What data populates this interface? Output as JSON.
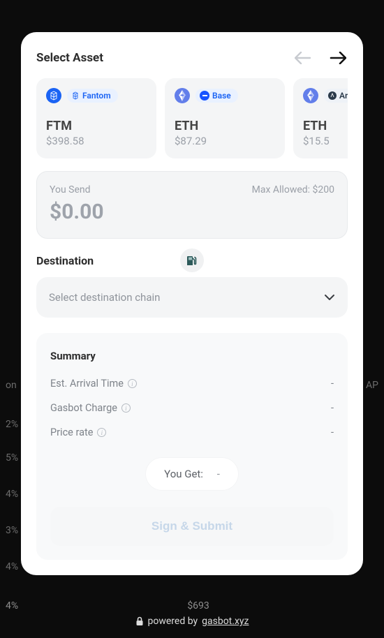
{
  "header": {
    "title": "Select Asset"
  },
  "assets": [
    {
      "chain": "Fantom",
      "symbol": "FTM",
      "value": "$398.58",
      "iconColor": "#1a63f4",
      "pillBg": "#e9f1ff",
      "pillColor": "#1a63f4"
    },
    {
      "chain": "Base",
      "symbol": "ETH",
      "value": "$87.29",
      "iconColor": "#627eea",
      "pillBg": "#e9f1ff",
      "pillColor": "#1a63f4",
      "pillPrefixDot": "#1853ff"
    },
    {
      "chain": "Arb",
      "symbol": "ETH",
      "value": "$15.5",
      "iconColor": "#627eea",
      "pillBg": "#eef2f7",
      "pillColor": "#2b3a4a"
    }
  ],
  "send": {
    "label": "You Send",
    "maxLabel": "Max Allowed: $200",
    "amount": "$0.00"
  },
  "destination": {
    "title": "Destination",
    "placeholder": "Select destination chain"
  },
  "summary": {
    "title": "Summary",
    "lines": [
      {
        "label": "Est. Arrival Time",
        "value": "-"
      },
      {
        "label": "Gasbot Charge",
        "value": "-"
      },
      {
        "label": "Price rate",
        "value": "-"
      }
    ],
    "youGetLabel": "You Get:",
    "youGetValue": "-"
  },
  "submitLabel": "Sign & Submit",
  "footer": {
    "prefix": "powered by",
    "link": "gasbot.xyz"
  }
}
